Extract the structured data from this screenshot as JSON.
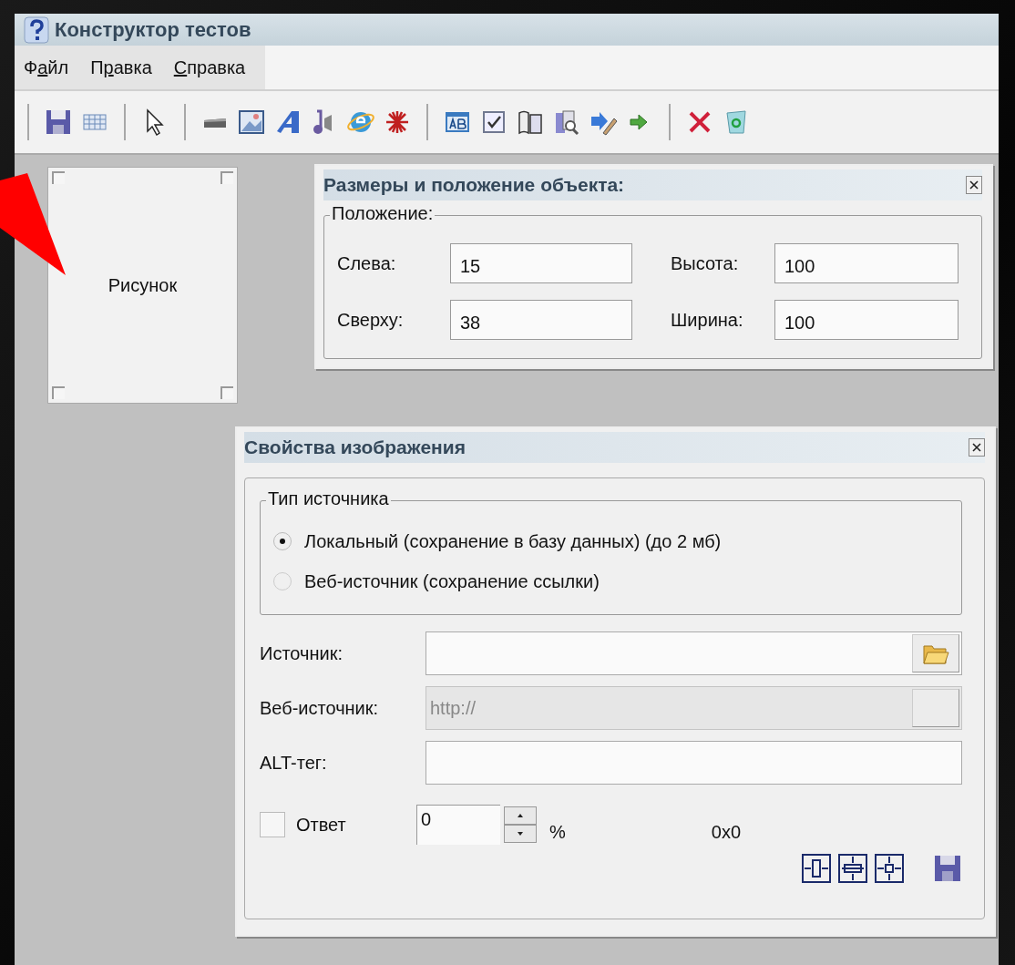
{
  "window": {
    "title": "Конструктор тестов"
  },
  "menu": [
    {
      "before": "Ф",
      "key": "а",
      "after": "йл"
    },
    {
      "before": "П",
      "key": "р",
      "after": "авка"
    },
    {
      "key": "С",
      "after": "правка"
    }
  ],
  "canvas_object": {
    "label": "Рисунок"
  },
  "size_panel": {
    "title": "Размеры и положение объекта:",
    "group": "Положение:",
    "fields": [
      {
        "label": "Слева:",
        "value": "15"
      },
      {
        "label": "Высота:",
        "value": "100"
      },
      {
        "label": "Сверху:",
        "value": "38"
      },
      {
        "label": "Ширина:",
        "value": "100"
      }
    ]
  },
  "image_panel": {
    "title": "Свойства изображения",
    "group": "Тип источника",
    "radios": [
      {
        "label": "Локальный (сохранение в базу данных) (до 2 мб)",
        "selected": true
      },
      {
        "label": "Веб-источник (сохранение ссылки)",
        "selected": false
      }
    ],
    "fields": [
      {
        "kind": "browse",
        "label": "Источник:",
        "disabled": false
      },
      {
        "kind": "web",
        "label": "Веб-источник:",
        "value": "http://",
        "disabled": true
      },
      {
        "kind": "plain",
        "label": "ALT-тег:",
        "disabled": false
      }
    ],
    "answer": {
      "label": "Ответ",
      "checked": false
    },
    "percent": {
      "value": "0",
      "unit": "%"
    },
    "dimensions": "0x0"
  }
}
